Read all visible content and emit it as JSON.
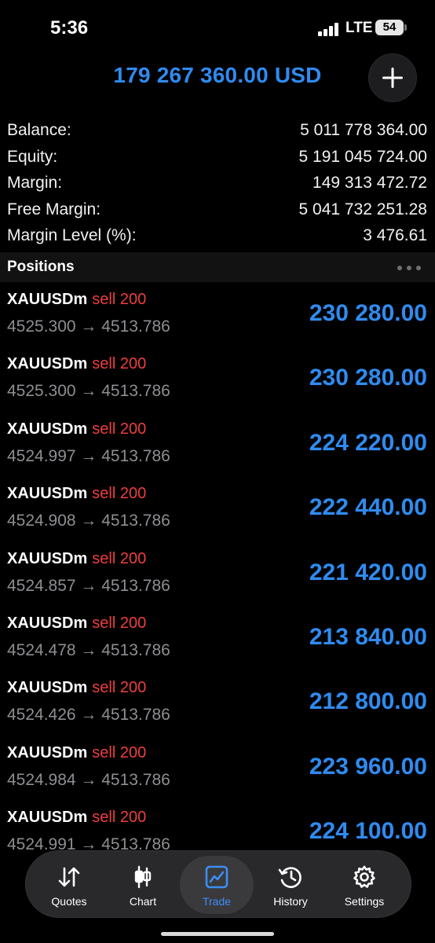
{
  "status_bar": {
    "time": "5:36",
    "network": "LTE",
    "battery": "54"
  },
  "header": {
    "total": "179 267 360.00 USD",
    "add_icon": "plus-icon"
  },
  "summary": [
    {
      "label": "Balance:",
      "value": "5 011 778 364.00"
    },
    {
      "label": "Equity:",
      "value": "5 191 045 724.00"
    },
    {
      "label": "Margin:",
      "value": "149 313 472.72"
    },
    {
      "label": "Free Margin:",
      "value": "5 041 732 251.28"
    },
    {
      "label": "Margin Level (%):",
      "value": "3 476.61"
    }
  ],
  "positions_section": {
    "title": "Positions",
    "more_icon": "ellipsis-icon"
  },
  "positions": [
    {
      "symbol": "XAUUSDm",
      "side": "sell 200",
      "prices": "4525.300 → 4513.786",
      "profit": "230 280.00"
    },
    {
      "symbol": "XAUUSDm",
      "side": "sell 200",
      "prices": "4525.300 → 4513.786",
      "profit": "230 280.00"
    },
    {
      "symbol": "XAUUSDm",
      "side": "sell 200",
      "prices": "4524.997 → 4513.786",
      "profit": "224 220.00"
    },
    {
      "symbol": "XAUUSDm",
      "side": "sell 200",
      "prices": "4524.908 → 4513.786",
      "profit": "222 440.00"
    },
    {
      "symbol": "XAUUSDm",
      "side": "sell 200",
      "prices": "4524.857 → 4513.786",
      "profit": "221 420.00"
    },
    {
      "symbol": "XAUUSDm",
      "side": "sell 200",
      "prices": "4524.478 → 4513.786",
      "profit": "213 840.00"
    },
    {
      "symbol": "XAUUSDm",
      "side": "sell 200",
      "prices": "4524.426 → 4513.786",
      "profit": "212 800.00"
    },
    {
      "symbol": "XAUUSDm",
      "side": "sell 200",
      "prices": "4524.984 → 4513.786",
      "profit": "223 960.00"
    },
    {
      "symbol": "XAUUSDm",
      "side": "sell 200",
      "prices": "4524.991 → 4513.786",
      "profit": "224 100.00"
    }
  ],
  "tabs": [
    {
      "label": "Quotes",
      "icon": "quotes-arrows-icon",
      "active": false
    },
    {
      "label": "Chart",
      "icon": "candlestick-icon",
      "active": false
    },
    {
      "label": "Trade",
      "icon": "trade-chart-icon",
      "active": true
    },
    {
      "label": "History",
      "icon": "history-clock-icon",
      "active": false
    },
    {
      "label": "Settings",
      "icon": "gear-icon",
      "active": false
    }
  ],
  "colors": {
    "accent": "#2f8bf0",
    "sell": "#ee3e3e",
    "muted": "#8e8e93"
  }
}
